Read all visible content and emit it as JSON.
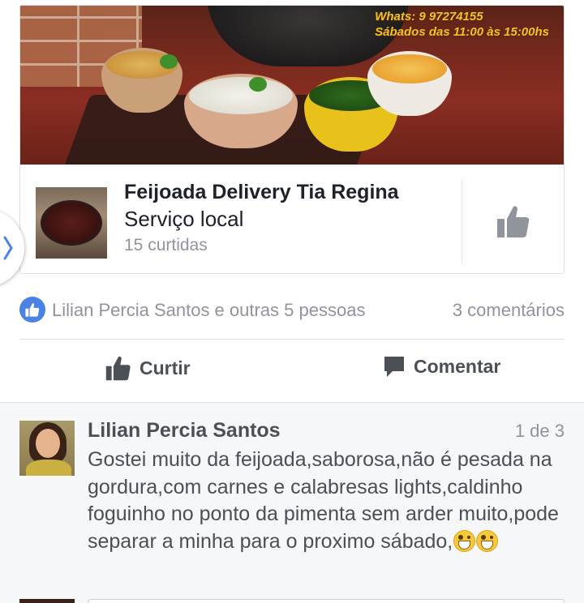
{
  "cover": {
    "phone_text": "Whats: 9 97274155",
    "hours_text": "Sábados das 11:00 às 15:00hs"
  },
  "page": {
    "name": "Feijoada Delivery Tia Regina",
    "category": "Serviço local",
    "likes": "15 curtidas",
    "like_icon": "thumbs-up-icon"
  },
  "reactions": {
    "likers": "Lilian Percia Santos e outras 5 pessoas",
    "comment_count": "3 comentários"
  },
  "actions": {
    "like_label": "Curtir",
    "comment_label": "Comentar"
  },
  "comment": {
    "author": "Lilian Percia Santos",
    "position": "1 de 3",
    "text": "Gostei muito da feijoada,saborosa,não é pesada na gordura,com carnes e calabresas lights,caldinho foguinho no ponto da pimenta sem arder muito,pode separar a minha para o proximo sábado,",
    "emojis": [
      "grinning-face-icon",
      "grinning-face-icon"
    ]
  },
  "colors": {
    "accent": "#4a82e6",
    "text_dark": "#1d2129",
    "text_muted": "#90949c",
    "cover_text": "#f2c028"
  }
}
